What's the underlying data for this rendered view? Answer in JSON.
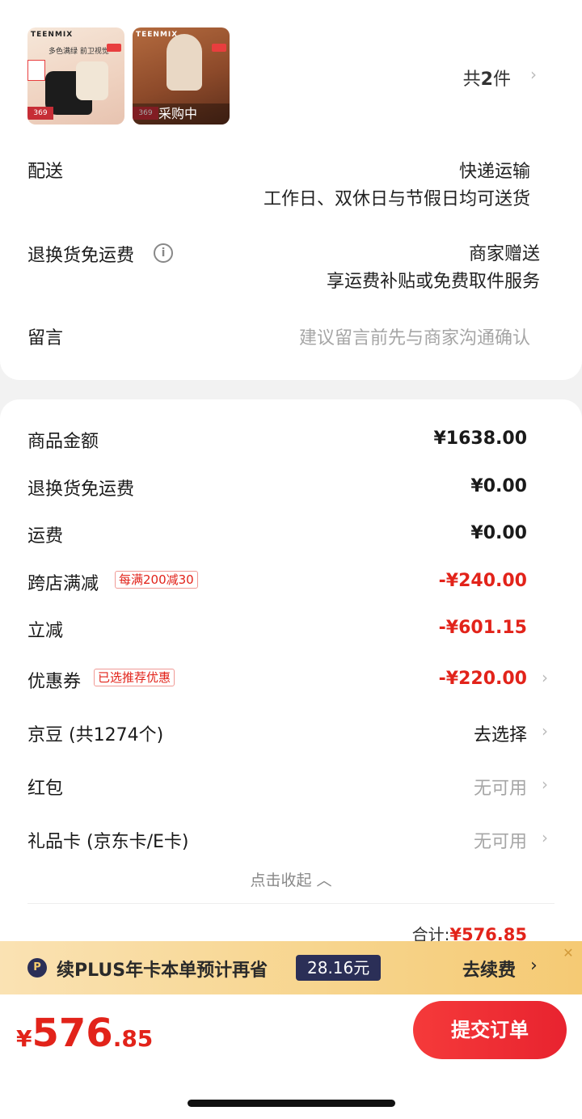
{
  "products": {
    "thumb1": {
      "brand": "TEENMIX",
      "tagline": "多色满绿 前卫视觉",
      "price": "369"
    },
    "thumb2": {
      "brand": "TEENMIX",
      "status": "采购中",
      "price": "369"
    },
    "count_prefix": "共",
    "count": "2",
    "count_suffix": "件"
  },
  "delivery": {
    "label": "配送",
    "method": "快递运输",
    "note": "工作日、双休日与节假日均可送货"
  },
  "return_shipping": {
    "label": "退换货免运费",
    "value": "商家赠送",
    "note": "享运费补贴或免费取件服务"
  },
  "message": {
    "label": "留言",
    "placeholder": "建议留言前先与商家沟通确认"
  },
  "fees": {
    "goods_amount": {
      "label": "商品金额",
      "value": "¥1638.00"
    },
    "return_fee": {
      "label": "退换货免运费",
      "value": "¥0.00"
    },
    "shipping": {
      "label": "运费",
      "value": "¥0.00"
    },
    "cross_store": {
      "label": "跨店满减",
      "tag": "每满200减30",
      "value": "-¥240.00"
    },
    "instant": {
      "label": "立减",
      "value": "-¥601.15"
    },
    "coupon": {
      "label": "优惠券",
      "tag": "已选推荐优惠",
      "value": "-¥220.00"
    },
    "jingdou": {
      "label": "京豆 (共1274个)",
      "value": "去选择"
    },
    "red_packet": {
      "label": "红包",
      "value": "无可用"
    },
    "gift_card": {
      "label": "礼品卡 (京东卡/E卡)",
      "value": "无可用"
    },
    "collapse": "点击收起 ︿",
    "total_label": "合计:",
    "total_value": "¥576.85"
  },
  "plus": {
    "logo": "P",
    "text": "续PLUS年卡本单预计再省",
    "amount": "28.16元",
    "action": "去续费",
    "chevron": "›",
    "close": "✕"
  },
  "bottom": {
    "currency": "¥",
    "pay_int": "576",
    "pay_dec": ".85",
    "submit": "提交订单"
  },
  "icons": {
    "chevron": "›",
    "info": "i"
  },
  "colors": {
    "accent_red": "#e2231a",
    "plus_navy": "#2b2f57",
    "plus_gold": "#f7d58e"
  }
}
